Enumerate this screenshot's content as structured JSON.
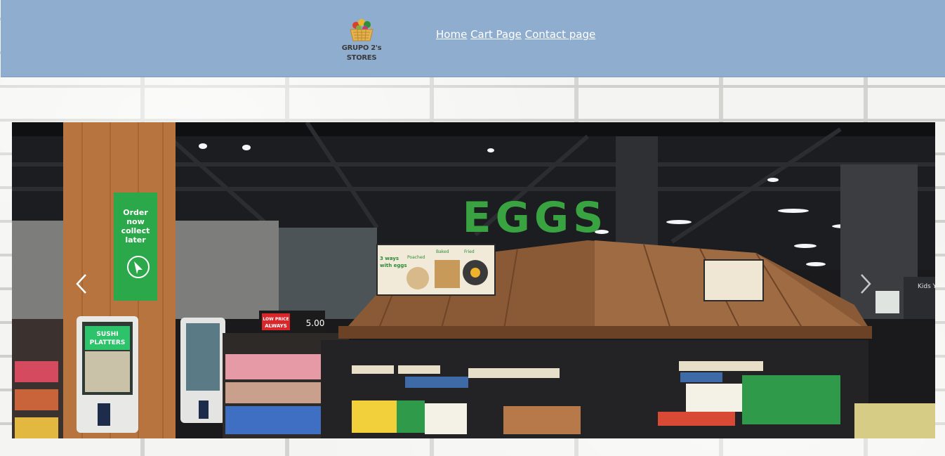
{
  "header": {
    "logo": {
      "line1": "GRUPO 2's",
      "line2": "STORES",
      "icon": "grocery-basket-icon"
    },
    "nav": [
      {
        "label": "Home"
      },
      {
        "label": "Cart Page"
      },
      {
        "label": "Contact page"
      }
    ],
    "background_color": "#8fadcf"
  },
  "carousel": {
    "image_subject": "supermarket-egg-aisle",
    "prev_icon": "chevron-left-icon",
    "next_icon": "chevron-right-icon",
    "signage": {
      "eggs": "EGGS",
      "kiosk_sign": [
        "Order",
        "now",
        "collect",
        "later"
      ],
      "sushi": [
        "SUSHI",
        "PLATTERS"
      ],
      "ways": [
        "3 ways",
        "with eggs"
      ],
      "ways_sub": [
        "Poached",
        "Baked",
        "Fried"
      ],
      "low_price": [
        "LOW PRICE",
        "ALWAYS"
      ],
      "price": "5.00",
      "kids": "Kids Y"
    }
  }
}
